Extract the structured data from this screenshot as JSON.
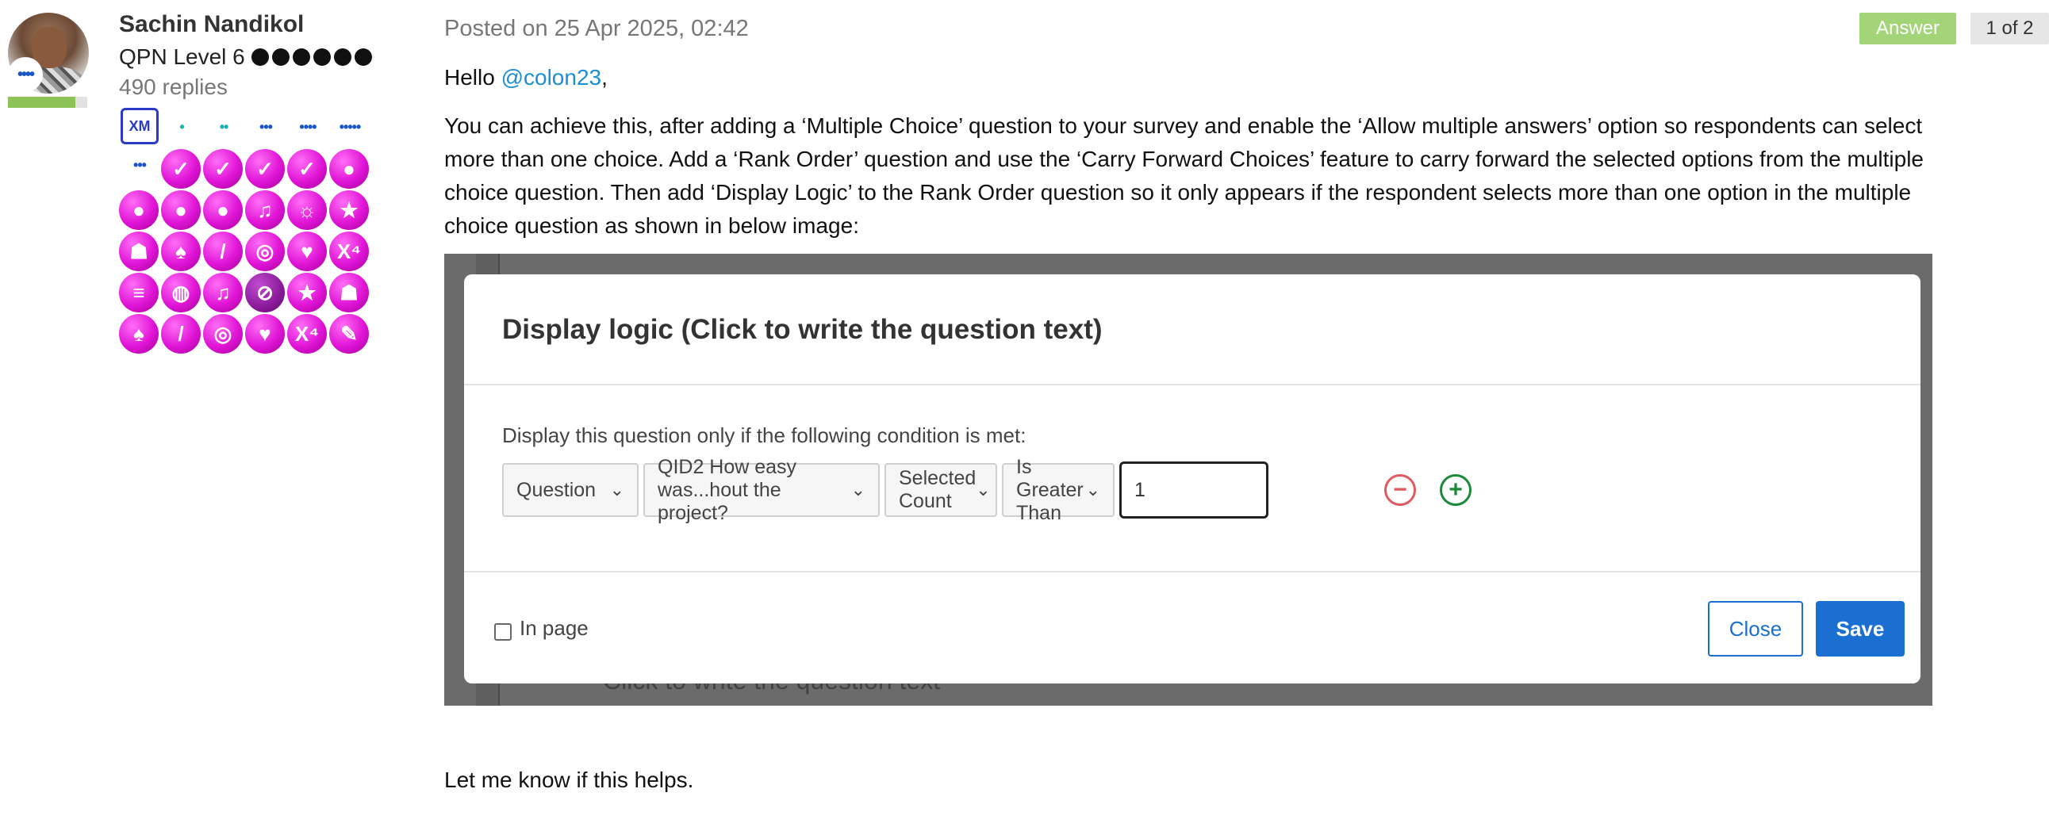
{
  "author": {
    "name": "Sachin Nandikol",
    "level": "QPN Level 6",
    "level_dots": 6,
    "replies": "490 replies",
    "rank_progress": 0.85
  },
  "badges": {
    "xm_badge": "XM",
    "row1_dots": [
      "•",
      "••",
      "•••",
      "••••",
      "•••••"
    ],
    "items": [
      {
        "row": 1,
        "col": 0,
        "icon": "dots-badge",
        "glyph": "•••"
      },
      {
        "row": 1,
        "col": 1,
        "icon": "check-badge",
        "glyph": "✓"
      },
      {
        "row": 1,
        "col": 2,
        "icon": "check-badge",
        "glyph": "✓"
      },
      {
        "row": 1,
        "col": 3,
        "icon": "check-badge",
        "glyph": "✓"
      },
      {
        "row": 1,
        "col": 4,
        "icon": "check-badge",
        "glyph": "✓"
      },
      {
        "row": 1,
        "col": 5,
        "icon": "speech-badge",
        "glyph": "●"
      },
      {
        "row": 2,
        "col": 0,
        "icon": "speech-badge",
        "glyph": "●"
      },
      {
        "row": 2,
        "col": 1,
        "icon": "speech-badge",
        "glyph": "●"
      },
      {
        "row": 2,
        "col": 2,
        "icon": "speech-badge",
        "glyph": "●"
      },
      {
        "row": 2,
        "col": 3,
        "icon": "music-badge",
        "glyph": "♫"
      },
      {
        "row": 2,
        "col": 4,
        "icon": "bulb-badge",
        "glyph": "☼"
      },
      {
        "row": 2,
        "col": 5,
        "icon": "star-badge",
        "glyph": "★"
      },
      {
        "row": 3,
        "col": 0,
        "icon": "ghost-badge",
        "glyph": "☗"
      },
      {
        "row": 3,
        "col": 1,
        "icon": "bird-badge",
        "glyph": "♠"
      },
      {
        "row": 3,
        "col": 2,
        "icon": "candy-badge",
        "glyph": "/"
      },
      {
        "row": 3,
        "col": 3,
        "icon": "target-badge",
        "glyph": "◎"
      },
      {
        "row": 3,
        "col": 4,
        "icon": "heart-badge",
        "glyph": "♥"
      },
      {
        "row": 3,
        "col": 5,
        "icon": "x4-badge",
        "glyph": "X⁴"
      },
      {
        "row": 4,
        "col": 0,
        "icon": "speed-badge",
        "glyph": "≡"
      },
      {
        "row": 4,
        "col": 1,
        "icon": "globe-badge",
        "glyph": "◍"
      },
      {
        "row": 4,
        "col": 2,
        "icon": "music-badge",
        "glyph": "♫"
      },
      {
        "row": 4,
        "col": 3,
        "icon": "tennis-badge",
        "glyph": "⊘"
      },
      {
        "row": 4,
        "col": 4,
        "icon": "star-badge",
        "glyph": "★"
      },
      {
        "row": 4,
        "col": 5,
        "icon": "ghost-badge",
        "glyph": "☗"
      },
      {
        "row": 5,
        "col": 0,
        "icon": "bird-badge",
        "glyph": "♠"
      },
      {
        "row": 5,
        "col": 1,
        "icon": "candy-badge",
        "glyph": "/"
      },
      {
        "row": 5,
        "col": 2,
        "icon": "target-badge",
        "glyph": "◎"
      },
      {
        "row": 5,
        "col": 3,
        "icon": "heart-badge",
        "glyph": "♥"
      },
      {
        "row": 5,
        "col": 4,
        "icon": "x4-badge",
        "glyph": "X⁴"
      },
      {
        "row": 5,
        "col": 5,
        "icon": "palette-badge",
        "glyph": "✎"
      }
    ]
  },
  "post": {
    "posted": "Posted on 25 Apr 2025, 02:42",
    "answer_tag": "Answer",
    "page_tag": "1 of 2",
    "greeting_prefix": "Hello ",
    "mention": "@colon23",
    "greeting_suffix": ",",
    "body": "You can achieve this, after adding a ‘Multiple Choice’ question to your survey and enable the ‘Allow multiple answers’ option so respondents can select more than one choice. Add a ‘Rank Order’ question and use the ‘Carry Forward Choices’ feature to carry forward the selected options from the multiple choice question. Then add ‘Display Logic’ to the Rank Order question so it only appears if the respondent selects more than one option in the multiple choice question as shown in below image:",
    "closing": "Let me know if this helps."
  },
  "screenshot": {
    "background_text": "Click to write the question text",
    "dialog_title": "Display logic (Click to write the question text)",
    "condition_label": "Display this question only if the following condition is met:",
    "dropdowns": [
      "Question",
      "QID2 How easy was...hout the project?",
      "Selected Count",
      "Is Greater Than"
    ],
    "value": "1",
    "in_page_label": "In page",
    "close_label": "Close",
    "save_label": "Save"
  },
  "colors": {
    "accent": "#1a6fd1",
    "mention": "#1a8fd6",
    "answer_tag": "#a3d477",
    "remove": "#e05a60",
    "add": "#1d8a3a",
    "badge": "#e014d6"
  }
}
